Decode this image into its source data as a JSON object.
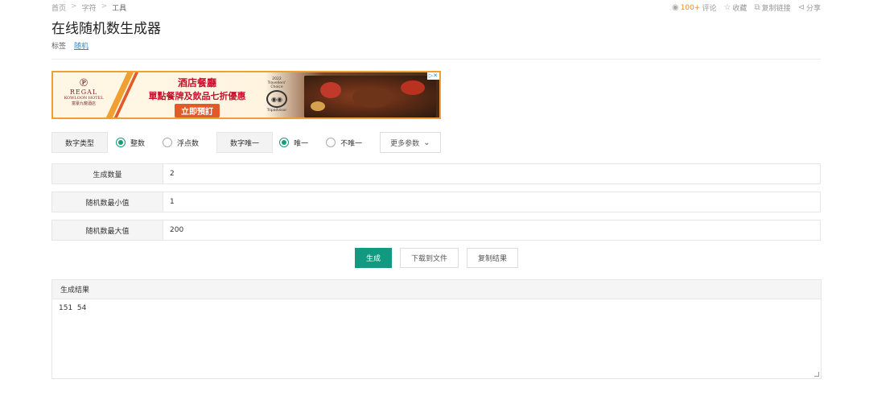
{
  "breadcrumb": [
    "首页",
    "字符",
    "工具"
  ],
  "breadcrumb_sep": ">",
  "actions": {
    "comments_count": "100+",
    "comments_label": "评论",
    "favorite": "收藏",
    "copy_link": "复制链接",
    "share": "分享"
  },
  "title": "在线随机数生成器",
  "tags": {
    "label": "标签",
    "items": [
      "随机"
    ]
  },
  "ad": {
    "brand": "REGAL",
    "brand_sub": "KOWLOON HOTEL",
    "brand_cn": "富豪九龍酒店",
    "line1": "酒店餐廳",
    "line2": "單點餐牌及飲品七折優惠",
    "cta": "立即預訂",
    "award_year": "2022",
    "award_line1": "Travellers'",
    "award_line2": "Choice",
    "award_org": "Tripadvisor"
  },
  "options": {
    "number_type_label": "数字类型",
    "integer": "整数",
    "float": "浮点数",
    "unique_label": "数字唯一",
    "unique": "唯一",
    "not_unique": "不唯一",
    "more_params": "更多参数"
  },
  "fields": {
    "count_label": "生成数量",
    "count_value": "2",
    "min_label": "随机数最小值",
    "min_value": "1",
    "max_label": "随机数最大值",
    "max_value": "200"
  },
  "buttons": {
    "generate": "生成",
    "download": "下载到文件",
    "copy": "复制结果"
  },
  "result": {
    "header": "生成结果",
    "value": "151  54"
  },
  "colors": {
    "accent": "#129a80",
    "link": "#2a8cc7",
    "hot": "#f08a24"
  }
}
